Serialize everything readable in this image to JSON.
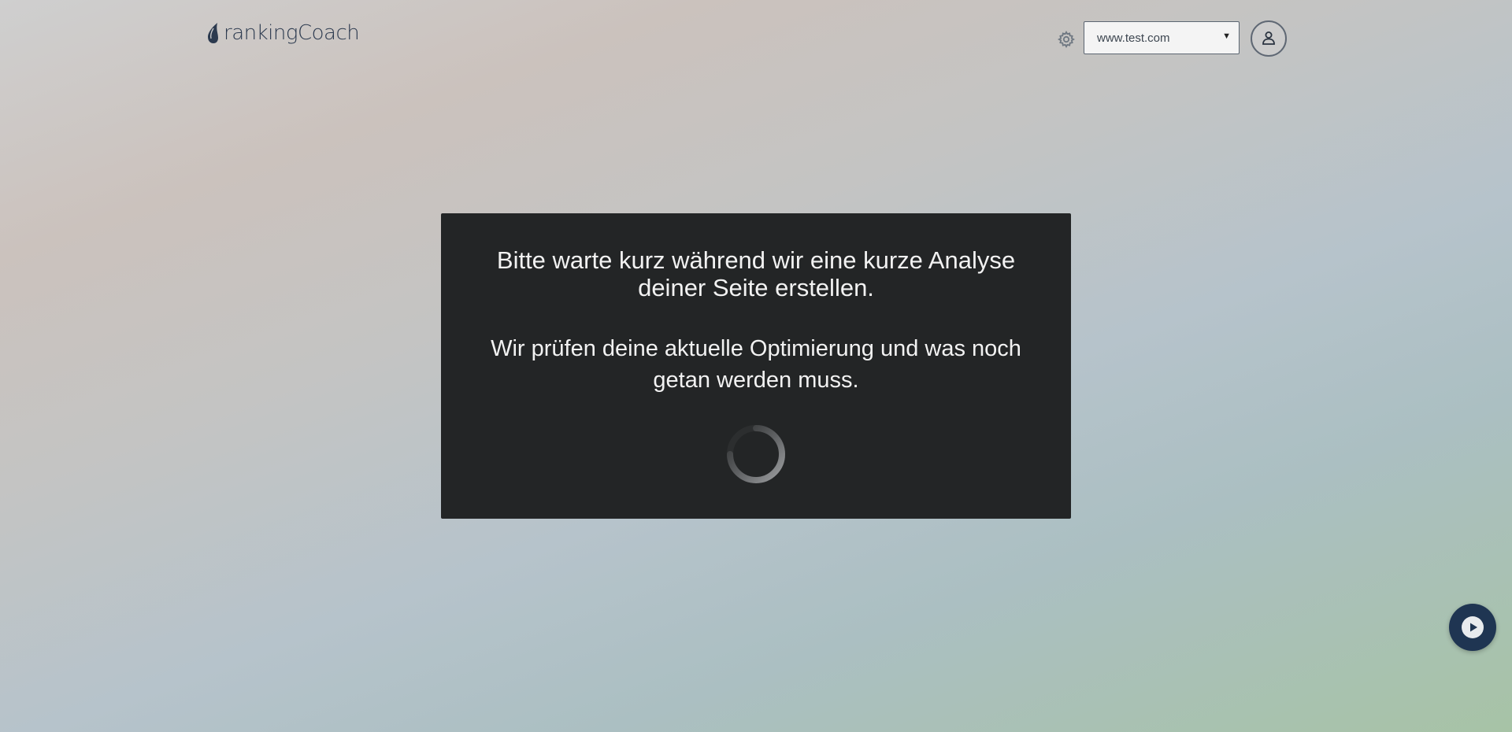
{
  "header": {
    "logo_text": "rankingCoach",
    "site_select": {
      "value": "www.test.com"
    }
  },
  "overlay": {
    "line1": "Bitte warte kurz während wir eine kurze Analyse deiner Seite erstellen.",
    "line2": "Wir prüfen deine aktuelle Optimierung und was noch getan werden muss."
  },
  "icons": {
    "logo": "rankingcoach-drop-icon",
    "settings": "gear-icon",
    "dropdown": "caret-down-icon",
    "user": "user-icon",
    "spinner": "loading-spinner-icon",
    "video": "play-icon"
  },
  "colors": {
    "logo_text": "#2c3a4f",
    "overlay_bg": "#232526",
    "overlay_text": "#f2f2f2",
    "play_button": "#1f3552"
  }
}
